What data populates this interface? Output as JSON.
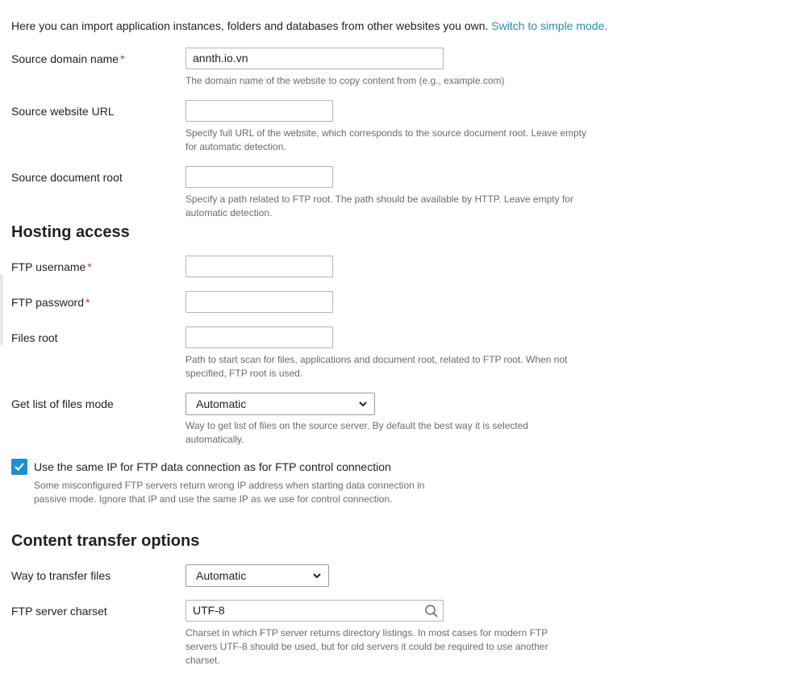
{
  "intro": {
    "text": "Here you can import application instances, folders and databases from other websites you own.",
    "link": "Switch to simple mode."
  },
  "fields": {
    "source_domain": {
      "label": "Source domain name",
      "required_mark": "*",
      "value": "annth.io.vn",
      "hint": "The domain name of the website to copy content from (e.g., example.com)"
    },
    "source_url": {
      "label": "Source website URL",
      "value": "",
      "hint": "Specify full URL of the website, which corresponds to the source document root. Leave empty for automatic detection."
    },
    "source_docroot": {
      "label": "Source document root",
      "value": "",
      "hint": "Specify a path related to FTP root. The path should be available by HTTP. Leave empty for automatic detection."
    }
  },
  "hosting": {
    "heading": "Hosting access",
    "ftp_username": {
      "label": "FTP username",
      "required_mark": "*",
      "value": ""
    },
    "ftp_password": {
      "label": "FTP password",
      "required_mark": "*",
      "value": ""
    },
    "files_root": {
      "label": "Files root",
      "value": "",
      "hint": "Path to start scan for files, applications and document root, related to FTP root. When not specified, FTP root is used."
    },
    "list_mode": {
      "label": "Get list of files mode",
      "selected": "Automatic",
      "hint": "Way to get list of files on the source server. By default the best way it is selected automatically."
    },
    "same_ip": {
      "checked": true,
      "label": "Use the same IP for FTP data connection as for FTP control connection",
      "hint": "Some misconfigured FTP servers return wrong IP address when starting data connection in passive mode. Ignore that IP and use the same IP as we use for control connection."
    }
  },
  "transfer": {
    "heading": "Content transfer options",
    "way": {
      "label": "Way to transfer files",
      "selected": "Automatic"
    },
    "charset": {
      "label": "FTP server charset",
      "value": "UTF-8",
      "hint": "Charset in which FTP server returns directory listings. In most cases for modern FTP servers UTF-8 should be used, but for old servers it could be required to use another charset."
    }
  },
  "icons": {
    "chevron": "chevron-down-icon",
    "check": "checkmark-icon",
    "search": "search-icon"
  },
  "colors": {
    "link": "#2a8bb5",
    "required": "#d02c2c",
    "checkbox": "#1e8fcf",
    "hint_text": "#6b6b6b"
  }
}
